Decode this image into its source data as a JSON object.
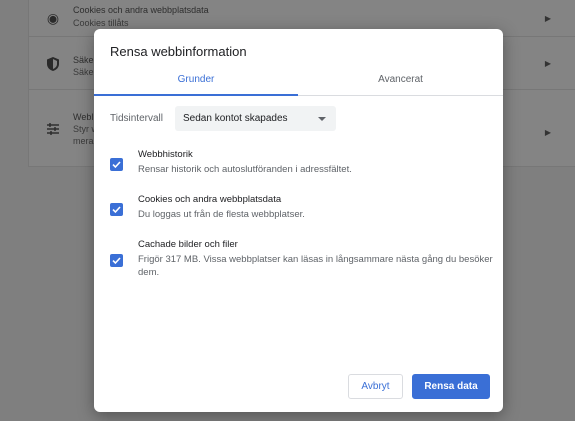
{
  "background": {
    "rows": [
      {
        "title": "Cookies och andra webbplatsdata",
        "subtitle": "Cookies tillåts",
        "icon": "cookie-icon"
      },
      {
        "title": "Säke",
        "subtitle": "Säke",
        "icon": "shield-icon"
      },
      {
        "title": "Webl",
        "subtitle": "Styr w",
        "subtitle2": "mera",
        "icon": "sliders-icon"
      }
    ]
  },
  "dialog": {
    "title": "Rensa webbinformation",
    "tabs": [
      {
        "label": "Grunder",
        "active": true
      },
      {
        "label": "Avancerat",
        "active": false
      }
    ],
    "time_range": {
      "label": "Tidsintervall",
      "selected": "Sedan kontot skapades"
    },
    "options": [
      {
        "title": "Webbhistorik",
        "description": "Rensar historik och autoslutföranden i adressfältet.",
        "checked": true
      },
      {
        "title": "Cookies och andra webbplatsdata",
        "description": "Du loggas ut från de flesta webbplatser.",
        "checked": true
      },
      {
        "title": "Cachade bilder och filer",
        "description": "Frigör 317 MB. Vissa webbplatser kan läsas in långsammare nästa gång du besöker dem.",
        "checked": true
      }
    ],
    "buttons": {
      "cancel": "Avbryt",
      "clear": "Rensa data"
    }
  },
  "colors": {
    "accent": "#3a6fd6",
    "overlay": "#7f7f7f"
  }
}
